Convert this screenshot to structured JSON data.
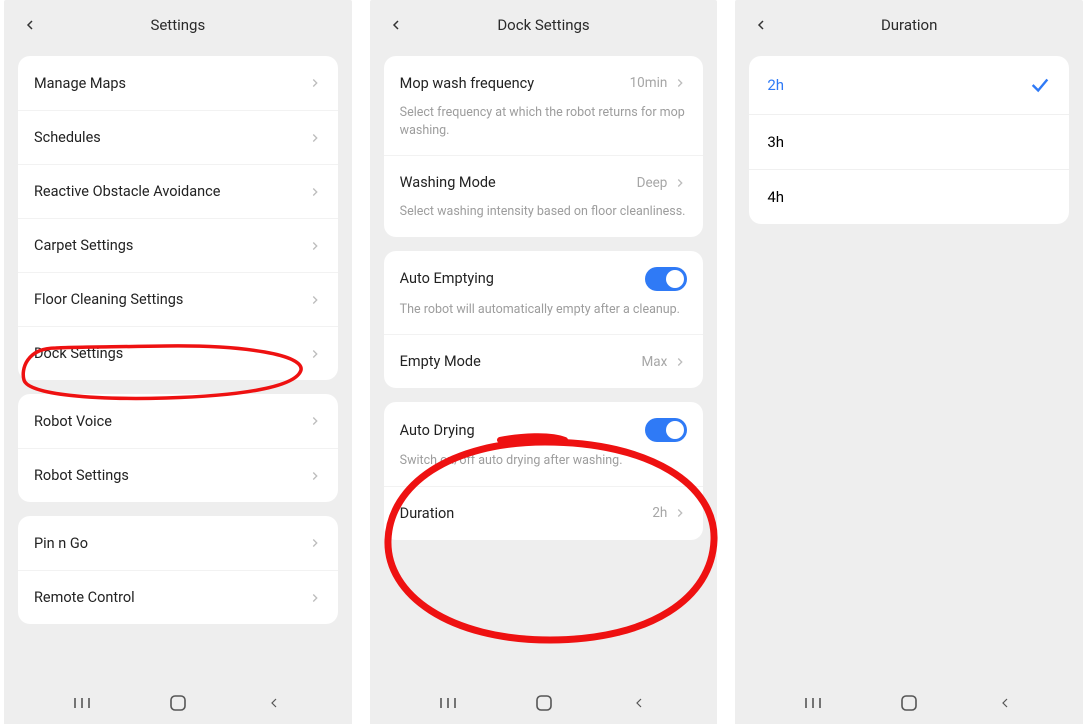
{
  "screen1": {
    "title": "Settings",
    "groups": [
      {
        "items": [
          {
            "name": "manage-maps",
            "label": "Manage Maps"
          },
          {
            "name": "schedules",
            "label": "Schedules"
          },
          {
            "name": "reactive-obstacle",
            "label": "Reactive Obstacle Avoidance"
          },
          {
            "name": "carpet-settings",
            "label": "Carpet Settings"
          },
          {
            "name": "floor-cleaning",
            "label": "Floor Cleaning Settings"
          },
          {
            "name": "dock-settings",
            "label": "Dock Settings"
          }
        ]
      },
      {
        "items": [
          {
            "name": "robot-voice",
            "label": "Robot Voice"
          },
          {
            "name": "robot-settings",
            "label": "Robot Settings"
          }
        ]
      },
      {
        "items": [
          {
            "name": "pin-n-go",
            "label": "Pin n Go"
          },
          {
            "name": "remote-control",
            "label": "Remote Control"
          }
        ]
      }
    ]
  },
  "screen2": {
    "title": "Dock Settings",
    "mop_wash_freq": {
      "label": "Mop wash frequency",
      "value": "10min",
      "desc": "Select frequency at which the robot returns for mop washing."
    },
    "washing_mode": {
      "label": "Washing Mode",
      "value": "Deep",
      "desc": "Select washing intensity based on floor cleanliness."
    },
    "auto_emptying": {
      "label": "Auto Emptying",
      "on": true,
      "desc": "The robot will automatically empty after a cleanup."
    },
    "empty_mode": {
      "label": "Empty Mode",
      "value": "Max"
    },
    "auto_drying": {
      "label": "Auto Drying",
      "on": true,
      "desc": "Switch on/off auto drying after washing."
    },
    "duration": {
      "label": "Duration",
      "value": "2h"
    }
  },
  "screen3": {
    "title": "Duration",
    "options": [
      {
        "label": "2h",
        "selected": true
      },
      {
        "label": "3h",
        "selected": false
      },
      {
        "label": "4h",
        "selected": false
      }
    ]
  }
}
